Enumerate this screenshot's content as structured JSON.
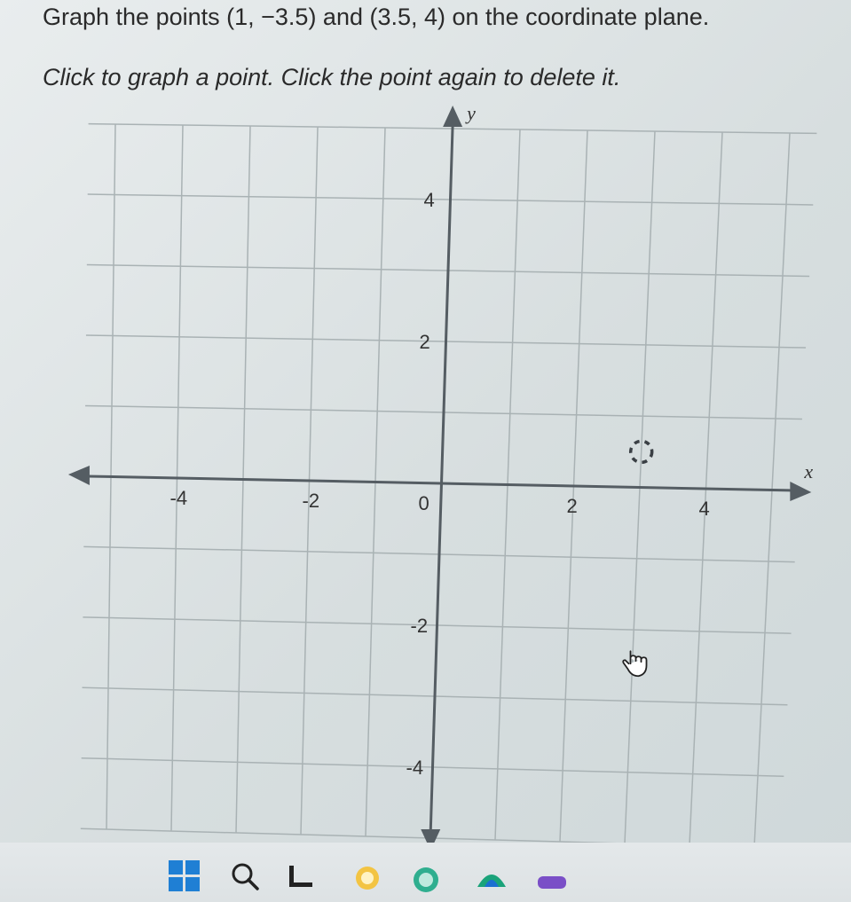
{
  "question": {
    "prompt": "Graph the points (1, −3.5) and (3.5, 4) on the coordinate plane.",
    "instruction": "Click to graph a point. Click the point again to delete it."
  },
  "graph": {
    "x_axis_label": "x",
    "y_axis_label": "y",
    "x_range": [
      -5,
      5
    ],
    "y_range": [
      -5,
      5
    ],
    "x_tick_labels": [
      {
        "value": -4,
        "text": "-4"
      },
      {
        "value": -2,
        "text": "-2"
      },
      {
        "value": 2,
        "text": "2"
      },
      {
        "value": 4,
        "text": "4"
      }
    ],
    "y_tick_labels": [
      {
        "value": 4,
        "text": "4"
      },
      {
        "value": 2,
        "text": "2"
      },
      {
        "value": -2,
        "text": "-2"
      },
      {
        "value": -4,
        "text": "-4"
      }
    ],
    "origin_label": "0",
    "grid": true,
    "hover_marker": {
      "x": 3,
      "y": 0.5
    },
    "cursor_position": {
      "x": 3,
      "y": -2.5
    }
  },
  "colors": {
    "grid_line": "#a9b2b4",
    "axis_line": "#555d63",
    "marker": "#3a3f44",
    "windows_blue": "#1f7fd4"
  },
  "taskbar": {
    "icons": [
      "windows-start-icon",
      "search-icon",
      "widgets-icon",
      "app-icon",
      "app-icon",
      "app-icon",
      "app-icon"
    ]
  }
}
